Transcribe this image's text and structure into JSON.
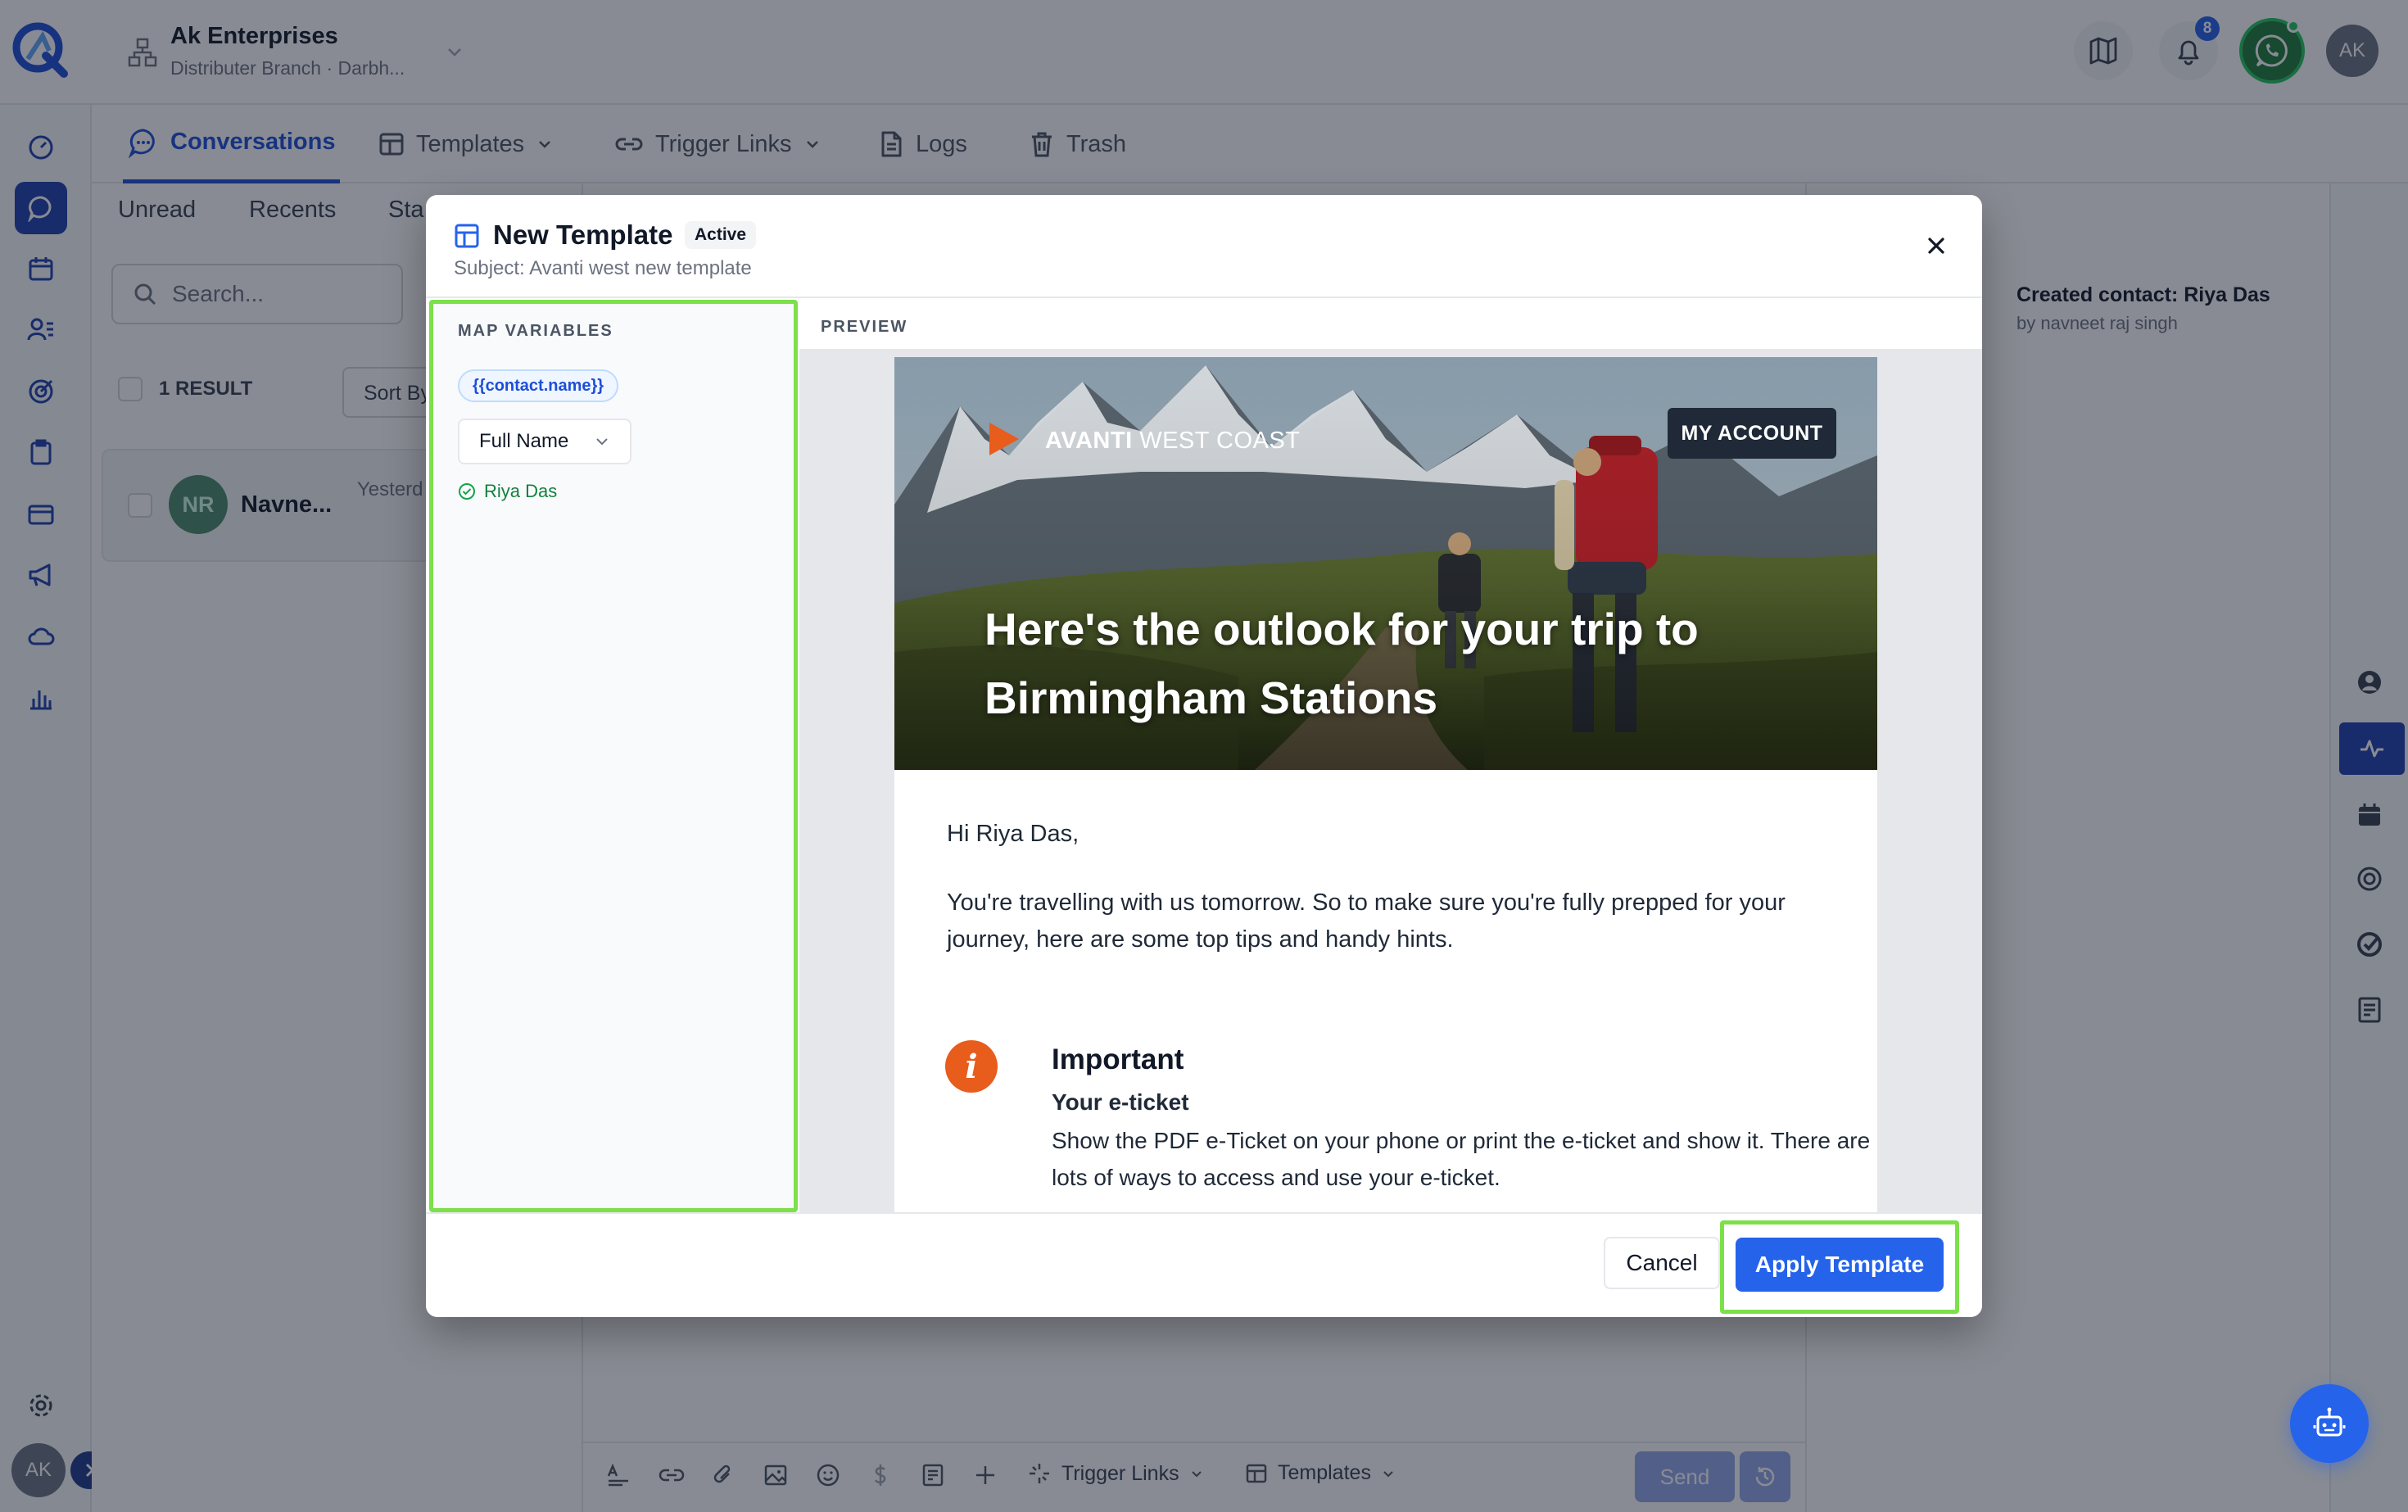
{
  "account": {
    "name": "Ak Enterprises",
    "subtitle": "Distributer Branch · Darbh..."
  },
  "header": {
    "notification_count": "8",
    "user_initials": "AK"
  },
  "tabs": [
    {
      "label": "Conversations"
    },
    {
      "label": "Templates"
    },
    {
      "label": "Trigger Links"
    },
    {
      "label": "Logs"
    },
    {
      "label": "Trash"
    }
  ],
  "subtabs": [
    "Unread",
    "Recents",
    "Sta"
  ],
  "conversations": {
    "search_placeholder": "Search...",
    "result_count": "1 RESULT",
    "sort_label": "Sort By",
    "item": {
      "initials": "NR",
      "name": "Navne...",
      "time": "Yesterd"
    }
  },
  "activity": {
    "title": "Created contact: Riya Das",
    "subtitle": "by navneet raj singh"
  },
  "composer": {
    "trigger_links": "Trigger Links",
    "templates": "Templates",
    "send": "Send"
  },
  "footer_user": {
    "initials": "AK"
  },
  "modal": {
    "title": "New Template",
    "status": "Active",
    "subject": "Subject: Avanti west new template",
    "map_title": "MAP VARIABLES",
    "variable_tag": "{{contact.name}}",
    "variable_field": "Full Name",
    "variable_value": "Riya Das",
    "preview_label": "PREVIEW",
    "cancel": "Cancel",
    "apply": "Apply Template"
  },
  "email": {
    "brand_bold": "AVANTI",
    "brand_rest": " WEST COAST",
    "account_button": "MY ACCOUNT",
    "hero_title": "Here's the outlook for your trip to Birmingham Stations",
    "greeting": "Hi Riya Das,",
    "intro": "You're travelling with us tomorrow. So to make sure you're fully prepped for your journey, here are some top tips and handy hints.",
    "important_icon": "i",
    "important_title": "Important",
    "important_subtitle": "Your e-ticket",
    "important_body": "Show the PDF e-Ticket on your phone or print the e-ticket and show it. There are lots of ways to access and use your e-ticket."
  },
  "colors": {
    "accent": "#2563eb",
    "highlight": "#7ce04a",
    "brand_orange": "#e85c1c",
    "whatsapp": "#25d366"
  }
}
